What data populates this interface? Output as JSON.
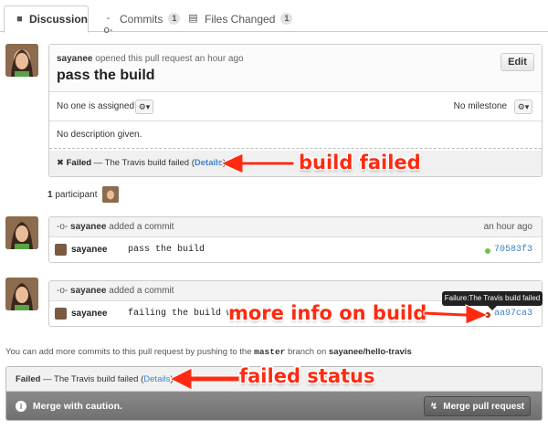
{
  "tabs": [
    {
      "label": "Discussion",
      "icon": "speech-bubbles-icon"
    },
    {
      "label": "Commits",
      "count": "1",
      "icon": "commit-icon"
    },
    {
      "label": "Files Changed",
      "count": "1",
      "icon": "file-diff-icon"
    }
  ],
  "pull_request": {
    "author": "sayanee",
    "meta_suffix": "opened this pull request an hour ago",
    "title": "pass the build",
    "edit_label": "Edit",
    "assignee_text": "No one is assigned",
    "milestone_text": "No milestone",
    "description": "No description given.",
    "status_failed": "Failed",
    "status_message": "— The Travis build failed (",
    "status_details": "Details",
    "status_close": ")"
  },
  "participants": {
    "count": "1",
    "label": "participant"
  },
  "commits": [
    {
      "author": "sayanee",
      "action": "added a commit",
      "time": "an hour ago",
      "row_author": "sayanee",
      "message": "pass the build",
      "sha": "70583f3",
      "status_color": "#6cc644"
    },
    {
      "author": "sayanee",
      "action": "added a commit",
      "time": "",
      "row_author": "sayanee",
      "message": "failing the build with",
      "sha": "aa97ca3",
      "status_color": "#bd2c00"
    }
  ],
  "tooltip": "Failure:The Travis build failed",
  "push_note": {
    "prefix": "You can add more commits to this pull request by pushing to the",
    "branch": "master",
    "middle": "branch on",
    "repo": "sayanee/hello-travis"
  },
  "merge": {
    "status_failed": "Failed",
    "status_message": "— The Travis build failed (",
    "status_details": "Details",
    "status_close": ")",
    "caution": "Merge with caution.",
    "button_label": "Merge pull request"
  },
  "annotations": {
    "build_failed": "build failed",
    "more_info": "more info on build",
    "failed_status": "failed status"
  },
  "colors": {
    "accent_link": "#4183c4",
    "annotation": "#ff2a10",
    "success": "#6cc644",
    "failure": "#bd2c00"
  }
}
